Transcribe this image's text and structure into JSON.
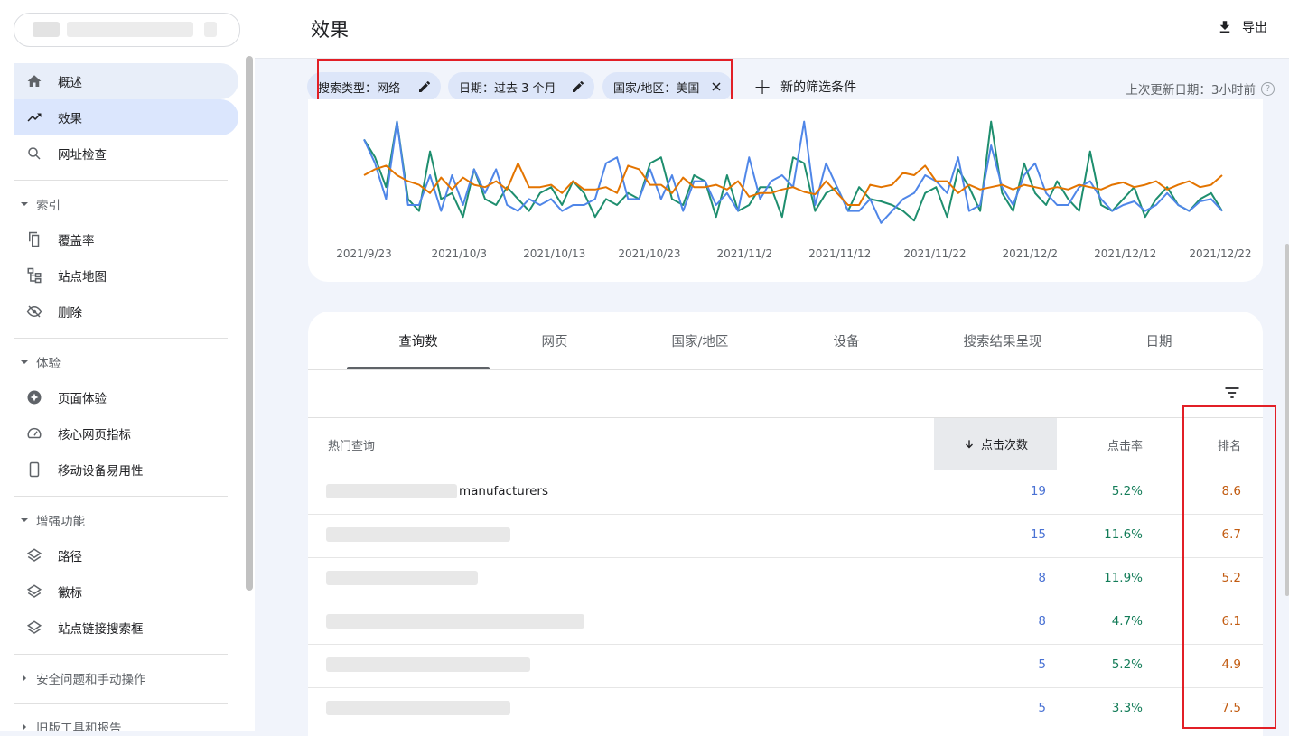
{
  "sidebar": {
    "property": "",
    "items": {
      "overview": "概述",
      "performance": "效果",
      "url_inspection": "网址检查",
      "index_header": "索引",
      "coverage": "覆盖率",
      "sitemaps": "站点地图",
      "removals": "删除",
      "experience_header": "体验",
      "page_experience": "页面体验",
      "core_web_vitals": "核心网页指标",
      "mobile_usability": "移动设备易用性",
      "enhancements_header": "增强功能",
      "breadcrumbs": "路径",
      "logos": "徽标",
      "sitelinks_searchbox": "站点链接搜索框",
      "security_header": "安全问题和手动操作",
      "legacy_header": "旧版工具和报告"
    }
  },
  "header": {
    "title": "效果",
    "export": "导出"
  },
  "filters": {
    "search_type": "搜索类型：网络",
    "date": "日期：过去 3 个月",
    "country": "国家/地区：美国",
    "add_filter": "新的筛选条件",
    "last_updated": "上次更新日期：3小时前",
    "help": "?"
  },
  "chart_data": {
    "type": "line",
    "x_ticks": [
      "2021/9/23",
      "2021/10/3",
      "2021/10/13",
      "2021/10/23",
      "2021/11/2",
      "2021/11/12",
      "2021/11/22",
      "2021/12/2",
      "2021/12/12",
      "2021/12/22"
    ],
    "ylim": [
      0,
      100
    ],
    "series": [
      {
        "color": "#1e8e6e",
        "values": [
          80,
          65,
          40,
          95,
          30,
          20,
          70,
          30,
          35,
          15,
          55,
          30,
          25,
          40,
          30,
          20,
          35,
          40,
          25,
          45,
          35,
          15,
          30,
          25,
          35,
          30,
          60,
          65,
          30,
          25,
          50,
          45,
          15,
          50,
          20,
          25,
          40,
          40,
          15,
          65,
          60,
          20,
          35,
          40,
          20,
          40,
          30,
          28,
          25,
          20,
          12,
          35,
          40,
          15,
          55,
          40,
          20,
          95,
          35,
          20,
          60,
          35,
          25,
          45,
          30,
          20,
          70,
          25,
          20,
          30,
          40,
          15,
          30,
          40,
          25,
          20,
          30,
          35,
          20
        ],
        "color_name": "green"
      },
      {
        "color": "#4f86e8",
        "values": [
          80,
          60,
          30,
          95,
          25,
          25,
          50,
          20,
          50,
          25,
          55,
          35,
          55,
          25,
          20,
          30,
          25,
          30,
          20,
          25,
          25,
          30,
          60,
          65,
          30,
          30,
          55,
          30,
          50,
          20,
          45,
          45,
          25,
          35,
          20,
          65,
          30,
          45,
          50,
          40,
          95,
          25,
          60,
          40,
          20,
          20,
          30,
          10,
          20,
          30,
          35,
          50,
          45,
          35,
          65,
          20,
          25,
          75,
          40,
          25,
          50,
          60,
          35,
          25,
          25,
          40,
          45,
          30,
          20,
          25,
          28,
          20,
          25,
          35,
          25,
          20,
          28,
          30,
          20
        ],
        "color_name": "blue"
      },
      {
        "color": "#e37400",
        "values": [
          50,
          55,
          58,
          50,
          45,
          42,
          35,
          48,
          38,
          48,
          42,
          40,
          45,
          38,
          60,
          40,
          40,
          42,
          35,
          45,
          38,
          38,
          40,
          35,
          58,
          55,
          42,
          42,
          35,
          48,
          40,
          40,
          42,
          38,
          45,
          32,
          35,
          35,
          38,
          40,
          36,
          34,
          45,
          35,
          25,
          25,
          42,
          40,
          42,
          52,
          50,
          58,
          45,
          45,
          35,
          42,
          38,
          40,
          42,
          38,
          42,
          40,
          38,
          40,
          38,
          42,
          40,
          38,
          42,
          44,
          40,
          42,
          45,
          38,
          42,
          45,
          40,
          42,
          50
        ],
        "color_name": "orange"
      }
    ]
  },
  "table": {
    "tabs": [
      "查询数",
      "网页",
      "国家/地区",
      "设备",
      "搜索结果呈现",
      "日期"
    ],
    "headers": {
      "query": "热门查询",
      "clicks": "点击次数",
      "ctr": "点击率",
      "position": "排名"
    },
    "rows": [
      {
        "query": "manufacturers",
        "clicks": "19",
        "ctr": "5.2%",
        "position": "8.6"
      },
      {
        "query": "",
        "clicks": "15",
        "ctr": "11.6%",
        "position": "6.7"
      },
      {
        "query": "",
        "clicks": "8",
        "ctr": "11.9%",
        "position": "5.2"
      },
      {
        "query": "",
        "clicks": "8",
        "ctr": "4.7%",
        "position": "6.1"
      },
      {
        "query": "",
        "clicks": "5",
        "ctr": "5.2%",
        "position": "4.9"
      },
      {
        "query": "",
        "clicks": "5",
        "ctr": "3.3%",
        "position": "7.5"
      }
    ]
  }
}
